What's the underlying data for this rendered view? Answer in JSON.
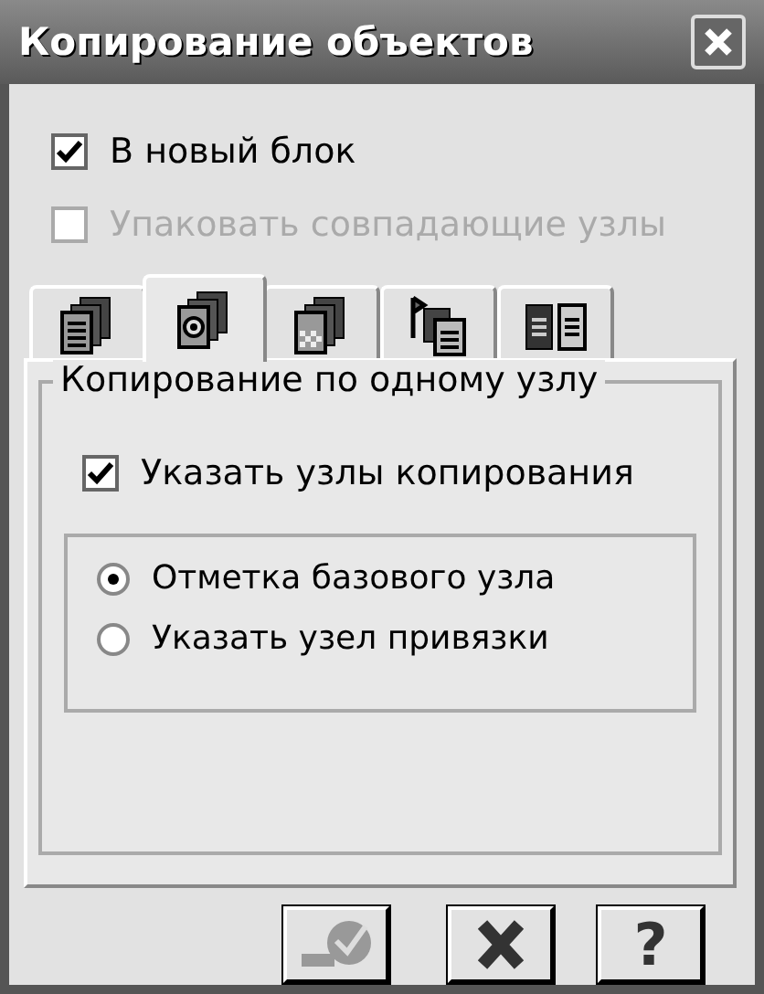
{
  "window": {
    "title": "Копирование объектов"
  },
  "options": [
    {
      "label": "В новый блок",
      "checked": true,
      "disabled": false
    },
    {
      "label": "Упаковать совпадающие узлы",
      "checked": false,
      "disabled": true
    }
  ],
  "tabs": [
    {
      "kind": "stack",
      "selected": false
    },
    {
      "kind": "gear",
      "selected": true
    },
    {
      "kind": "checker",
      "selected": false
    },
    {
      "kind": "flag",
      "selected": false
    },
    {
      "kind": "pair",
      "selected": false
    }
  ],
  "group": {
    "title": "Копирование по одному узлу",
    "checkbox": {
      "label": "Указать узлы копирования",
      "checked": true
    },
    "radios": [
      {
        "label": "Отметка базового узла",
        "selected": true
      },
      {
        "label": "Указать узел привязки",
        "selected": false
      }
    ]
  },
  "buttons": [
    {
      "kind": "ok",
      "disabled": true
    },
    {
      "kind": "cancel",
      "disabled": false
    },
    {
      "kind": "help",
      "text": "?",
      "disabled": false
    }
  ]
}
